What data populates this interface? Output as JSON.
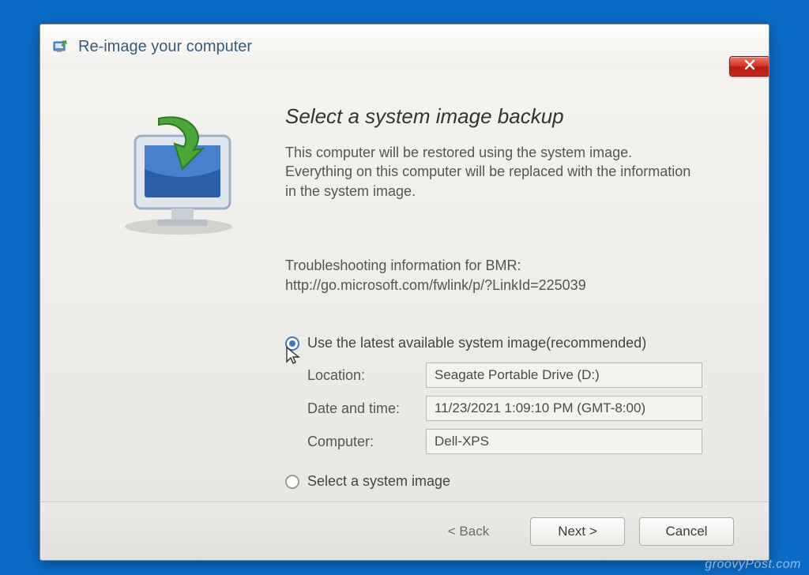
{
  "window": {
    "title": "Re-image your computer"
  },
  "main": {
    "heading": "Select a system image backup",
    "description": "This computer will be restored using the system image. Everything on this computer will be replaced with the information in the system image.",
    "troubleshoot_label": "Troubleshooting information for BMR:",
    "troubleshoot_url": "http://go.microsoft.com/fwlink/p/?LinkId=225039"
  },
  "options": {
    "use_latest_label": "Use the latest available system image(recommended)",
    "select_image_label": "Select a system image",
    "fields": {
      "location_label": "Location:",
      "location_value": "Seagate Portable Drive (D:)",
      "datetime_label": "Date and time:",
      "datetime_value": "11/23/2021 1:09:10 PM (GMT-8:00)",
      "computer_label": "Computer:",
      "computer_value": "Dell-XPS"
    }
  },
  "footer": {
    "back": "< Back",
    "next": "Next >",
    "cancel": "Cancel"
  },
  "watermark": "groovyPost.com"
}
